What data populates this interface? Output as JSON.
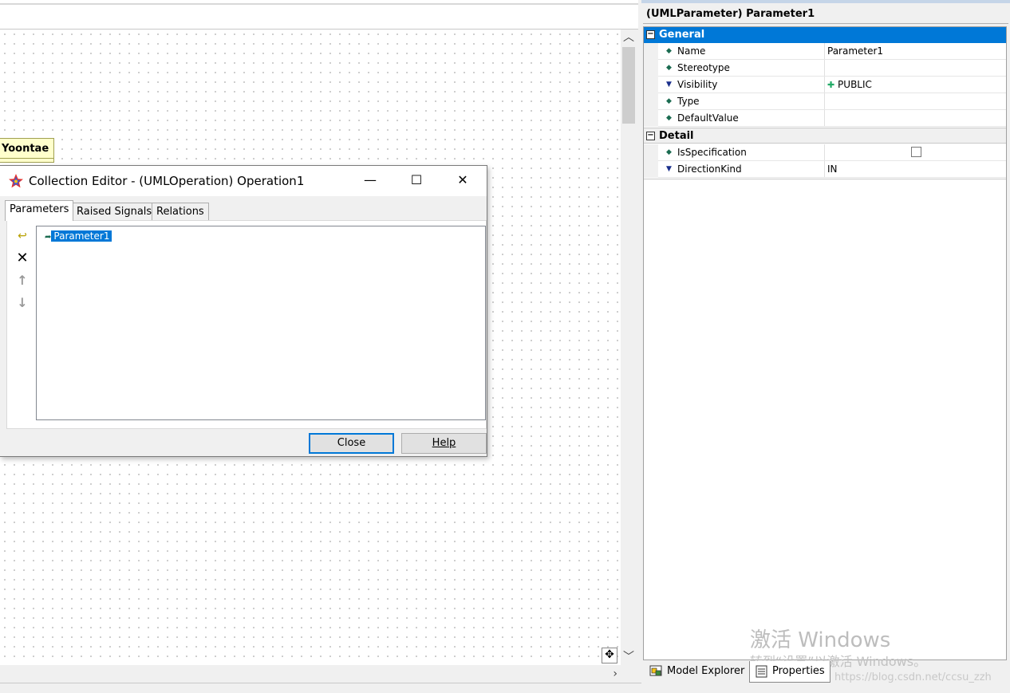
{
  "diagram": {
    "class_label": "Yoontae"
  },
  "dialog": {
    "title": "Collection Editor - (UMLOperation) Operation1",
    "window_buttons": {
      "minimize": "—",
      "maximize": "☐",
      "close": "✕"
    },
    "tabs": [
      {
        "label": "Parameters",
        "active": true
      },
      {
        "label": "Raised Signals",
        "active": false
      },
      {
        "label": "Relations",
        "active": false
      }
    ],
    "tools": [
      {
        "name": "add-icon",
        "glyph": "↩"
      },
      {
        "name": "delete-icon",
        "glyph": "✕"
      },
      {
        "name": "move-up-icon",
        "glyph": "↑"
      },
      {
        "name": "move-down-icon",
        "glyph": "↓"
      }
    ],
    "items": [
      {
        "label": "Parameter1",
        "selected": true
      }
    ],
    "close_label": "Close",
    "help_label": "Help"
  },
  "properties": {
    "header": "(UMLParameter) Parameter1",
    "categories": [
      {
        "label": "General",
        "toggle": "⊟",
        "rows": [
          {
            "key": "Name",
            "value": "Parameter1",
            "icon": "diamond"
          },
          {
            "key": "Stereotype",
            "value": "",
            "icon": "diamond"
          },
          {
            "key": "Visibility",
            "value": "PUBLIC",
            "icon": "triangle"
          },
          {
            "key": "Type",
            "value": "",
            "icon": "diamond"
          },
          {
            "key": "DefaultValue",
            "value": "",
            "icon": "diamond"
          }
        ]
      },
      {
        "label": "Detail",
        "toggle": "⊟",
        "rows": [
          {
            "key": "IsSpecification",
            "value": "",
            "icon": "diamond",
            "checkbox": false
          },
          {
            "key": "DirectionKind",
            "value": "IN",
            "icon": "triangle"
          }
        ]
      }
    ]
  },
  "bottom_tabs": [
    {
      "label": "Model Explorer",
      "active": false
    },
    {
      "label": "Properties",
      "active": true
    }
  ],
  "watermark": {
    "line1": "激活 Windows",
    "line2": "转到“设置”以激活 Windows。",
    "url": "https://blog.csdn.net/ccsu_zzh"
  },
  "colors": {
    "selection": "#0078d7",
    "class_fill": "#ffffcc"
  }
}
